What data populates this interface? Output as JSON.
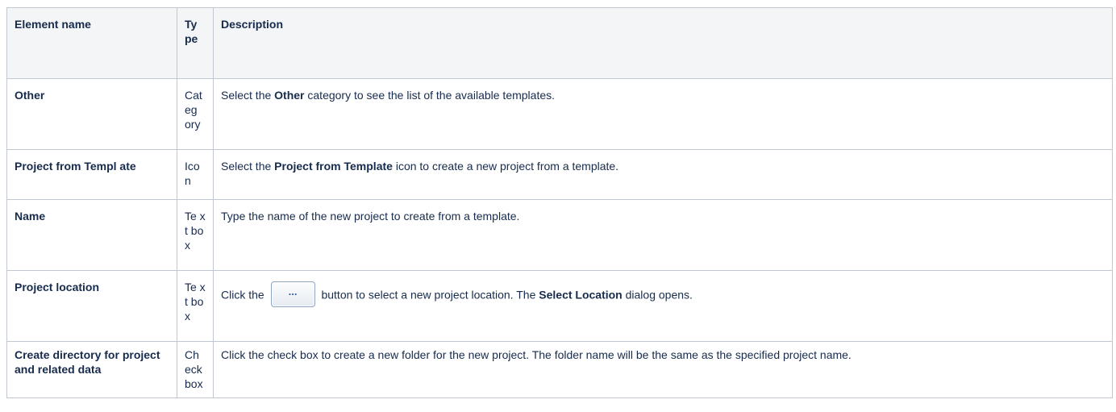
{
  "table": {
    "headers": [
      "Element name",
      "Ty pe",
      "Description"
    ],
    "rows": [
      {
        "name": "Other",
        "type": "Cat eg ory",
        "desc_pre": "Select the ",
        "desc_bold": "Other",
        "desc_post": " category to see the list of the available templates."
      },
      {
        "name": "Project from Templ ate",
        "type": "Icon",
        "desc_pre": "Select the ",
        "desc_bold": "Project from Template",
        "desc_post": " icon to create a new project from a template."
      },
      {
        "name": "Name",
        "type": "Te xt box",
        "desc": "Type the name of the new project to create from a template."
      },
      {
        "name": "Project location",
        "type": "Te xt box",
        "desc_pre": "Click the ",
        "button_icon": "ellipsis-button-icon",
        "button_label": "...",
        "desc_mid": " button to select a new project location. The ",
        "desc_bold": "Select Location",
        "desc_post": " dialog opens."
      },
      {
        "name": "Create directory for project and related data",
        "type": "Ch eck box",
        "desc": "Click the check box to create a new folder for the new project. The folder name will be the same as the specified project name."
      }
    ]
  }
}
